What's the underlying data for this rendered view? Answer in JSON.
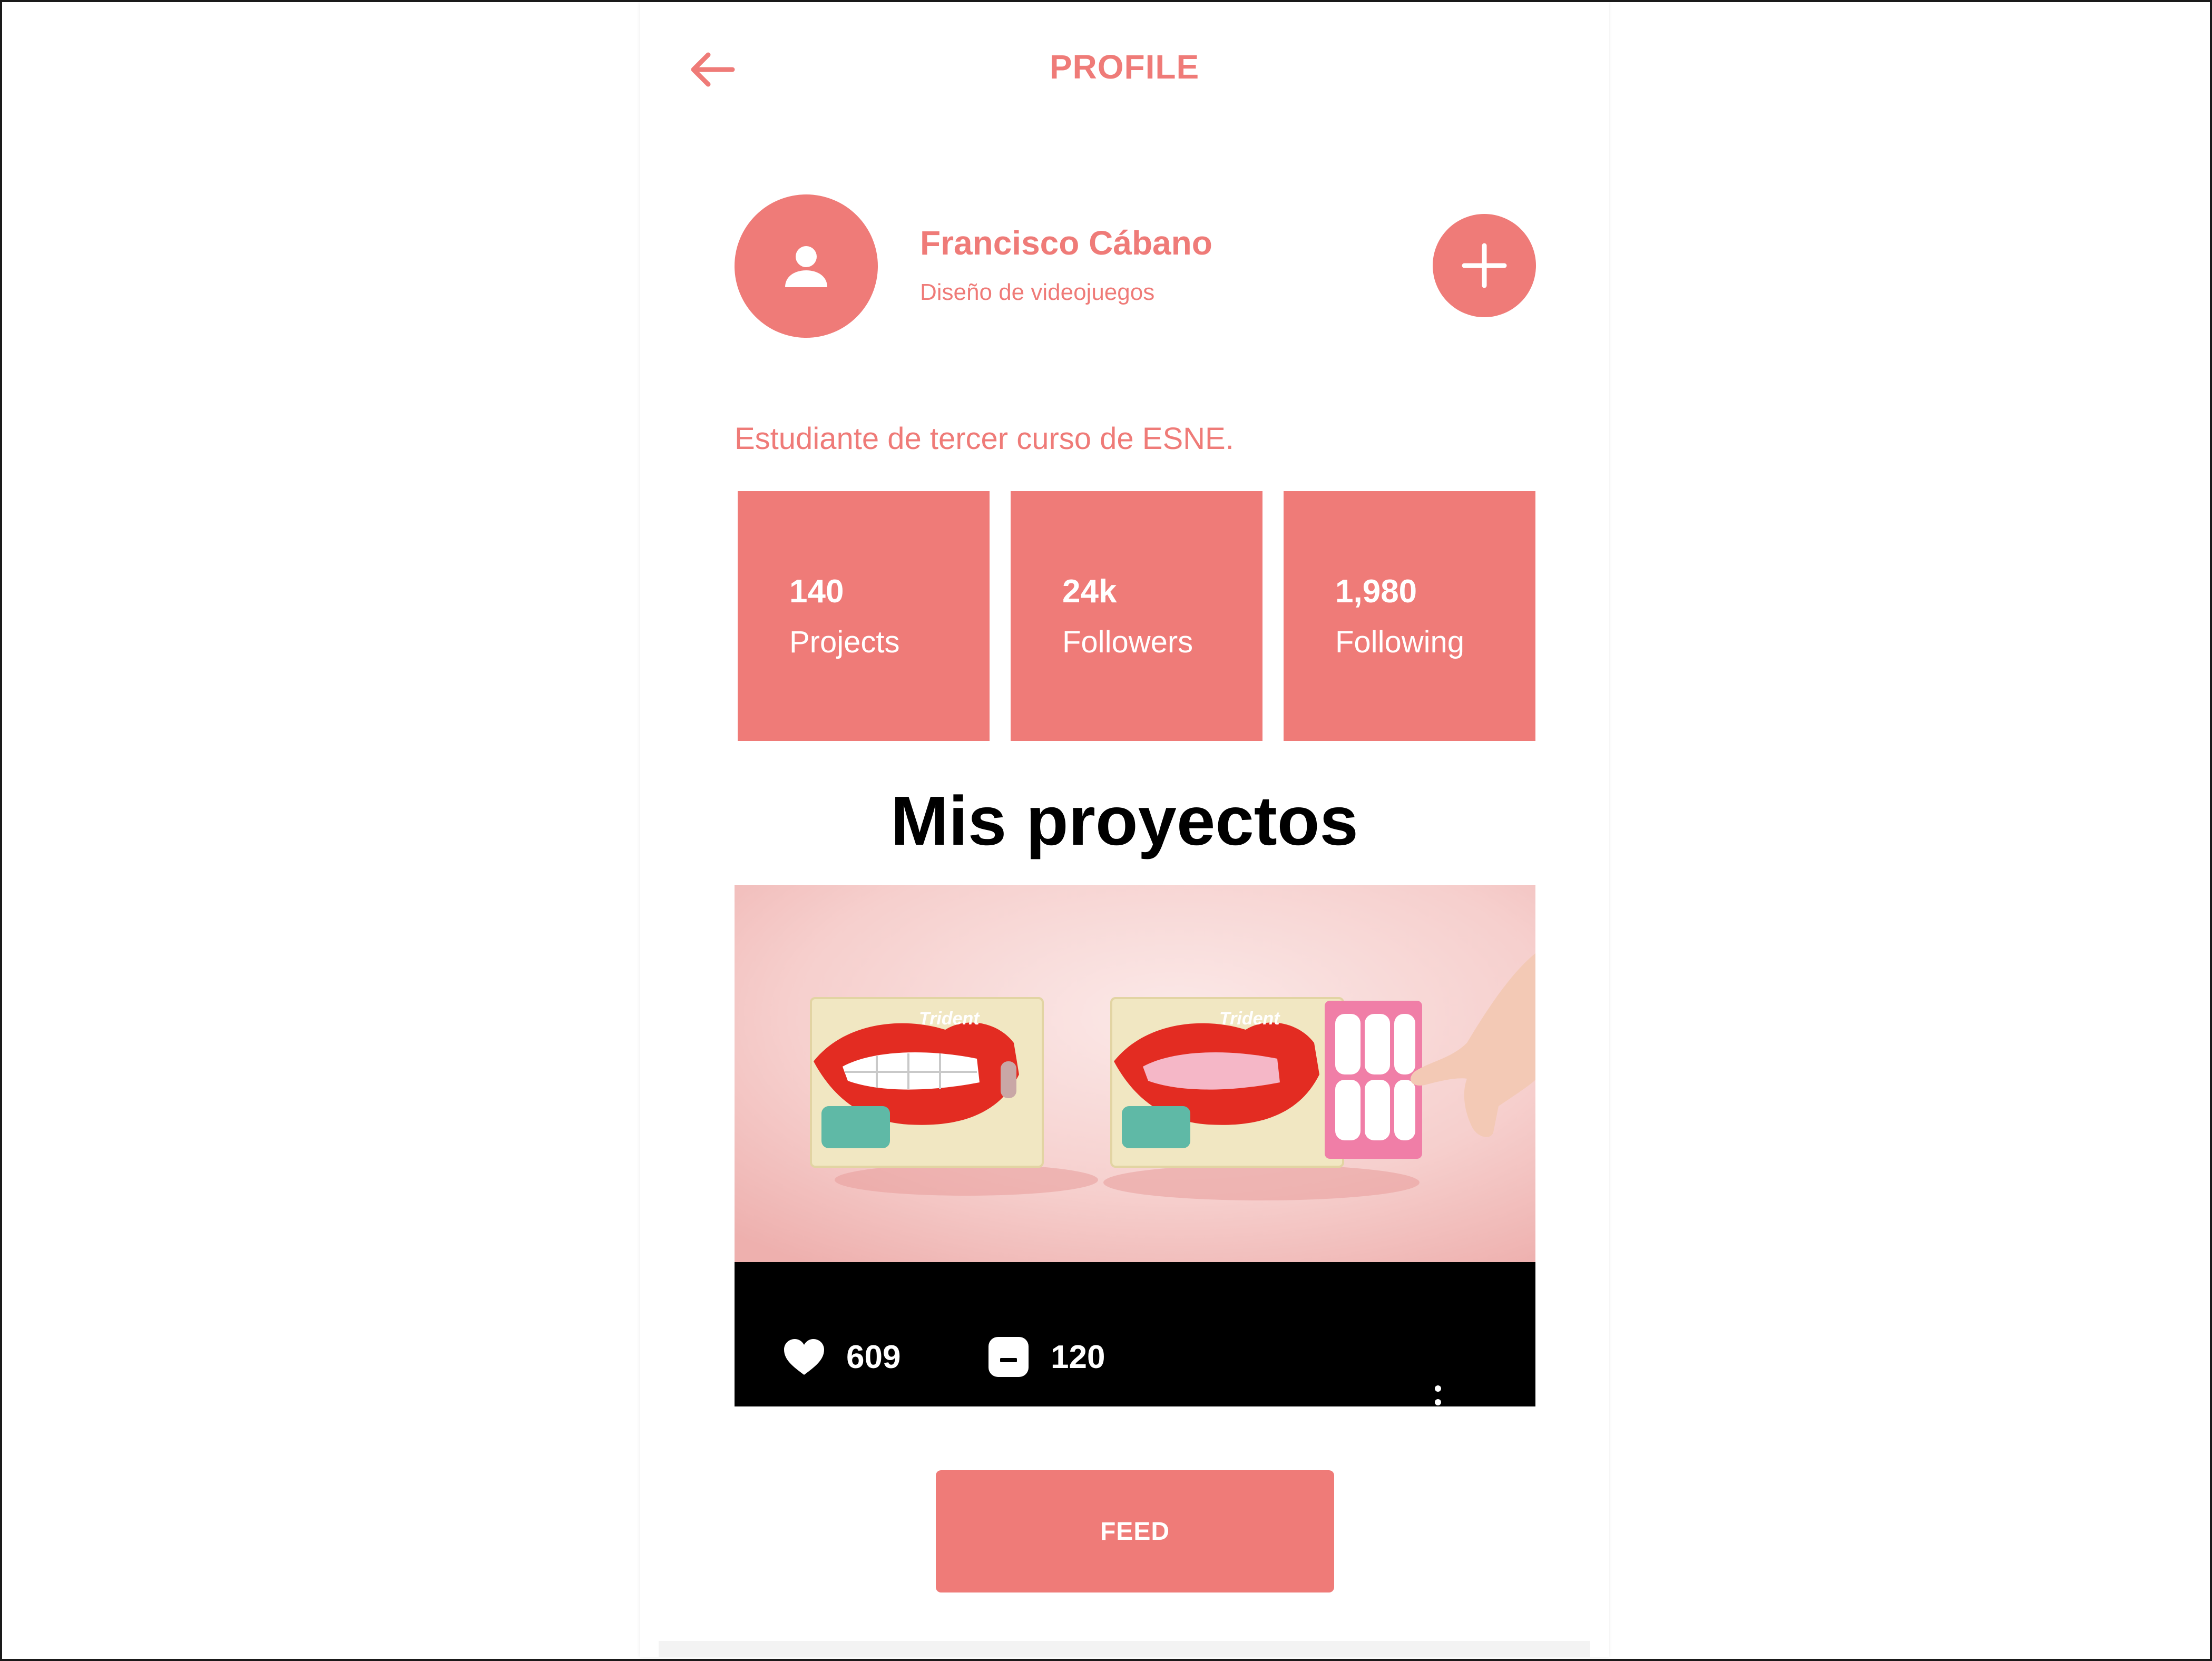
{
  "header": {
    "title": "PROFILE",
    "back_icon": "arrow-left-icon"
  },
  "profile": {
    "name": "Francisco Cábano",
    "role": "Diseño de videojuegos",
    "bio": "Estudiante de tercer curso de ESNE.",
    "avatar_icon": "person-icon",
    "add_icon": "plus-icon"
  },
  "stats": [
    {
      "value": "140",
      "label": "Projects"
    },
    {
      "value": "24k",
      "label": "Followers"
    },
    {
      "value": "1,980",
      "label": "Following"
    }
  ],
  "projects": {
    "title": "Mis proyectos",
    "items": [
      {
        "brand_text": "Trident",
        "likes": "609",
        "comments": "120",
        "like_icon": "heart-icon",
        "comment_icon": "comment-icon",
        "more_icon": "more-vertical-icon"
      }
    ]
  },
  "footer": {
    "feed_label": "FEED"
  },
  "colors": {
    "accent": "#ef7b78",
    "text_dark": "#000000",
    "card_footer": "#000000"
  }
}
